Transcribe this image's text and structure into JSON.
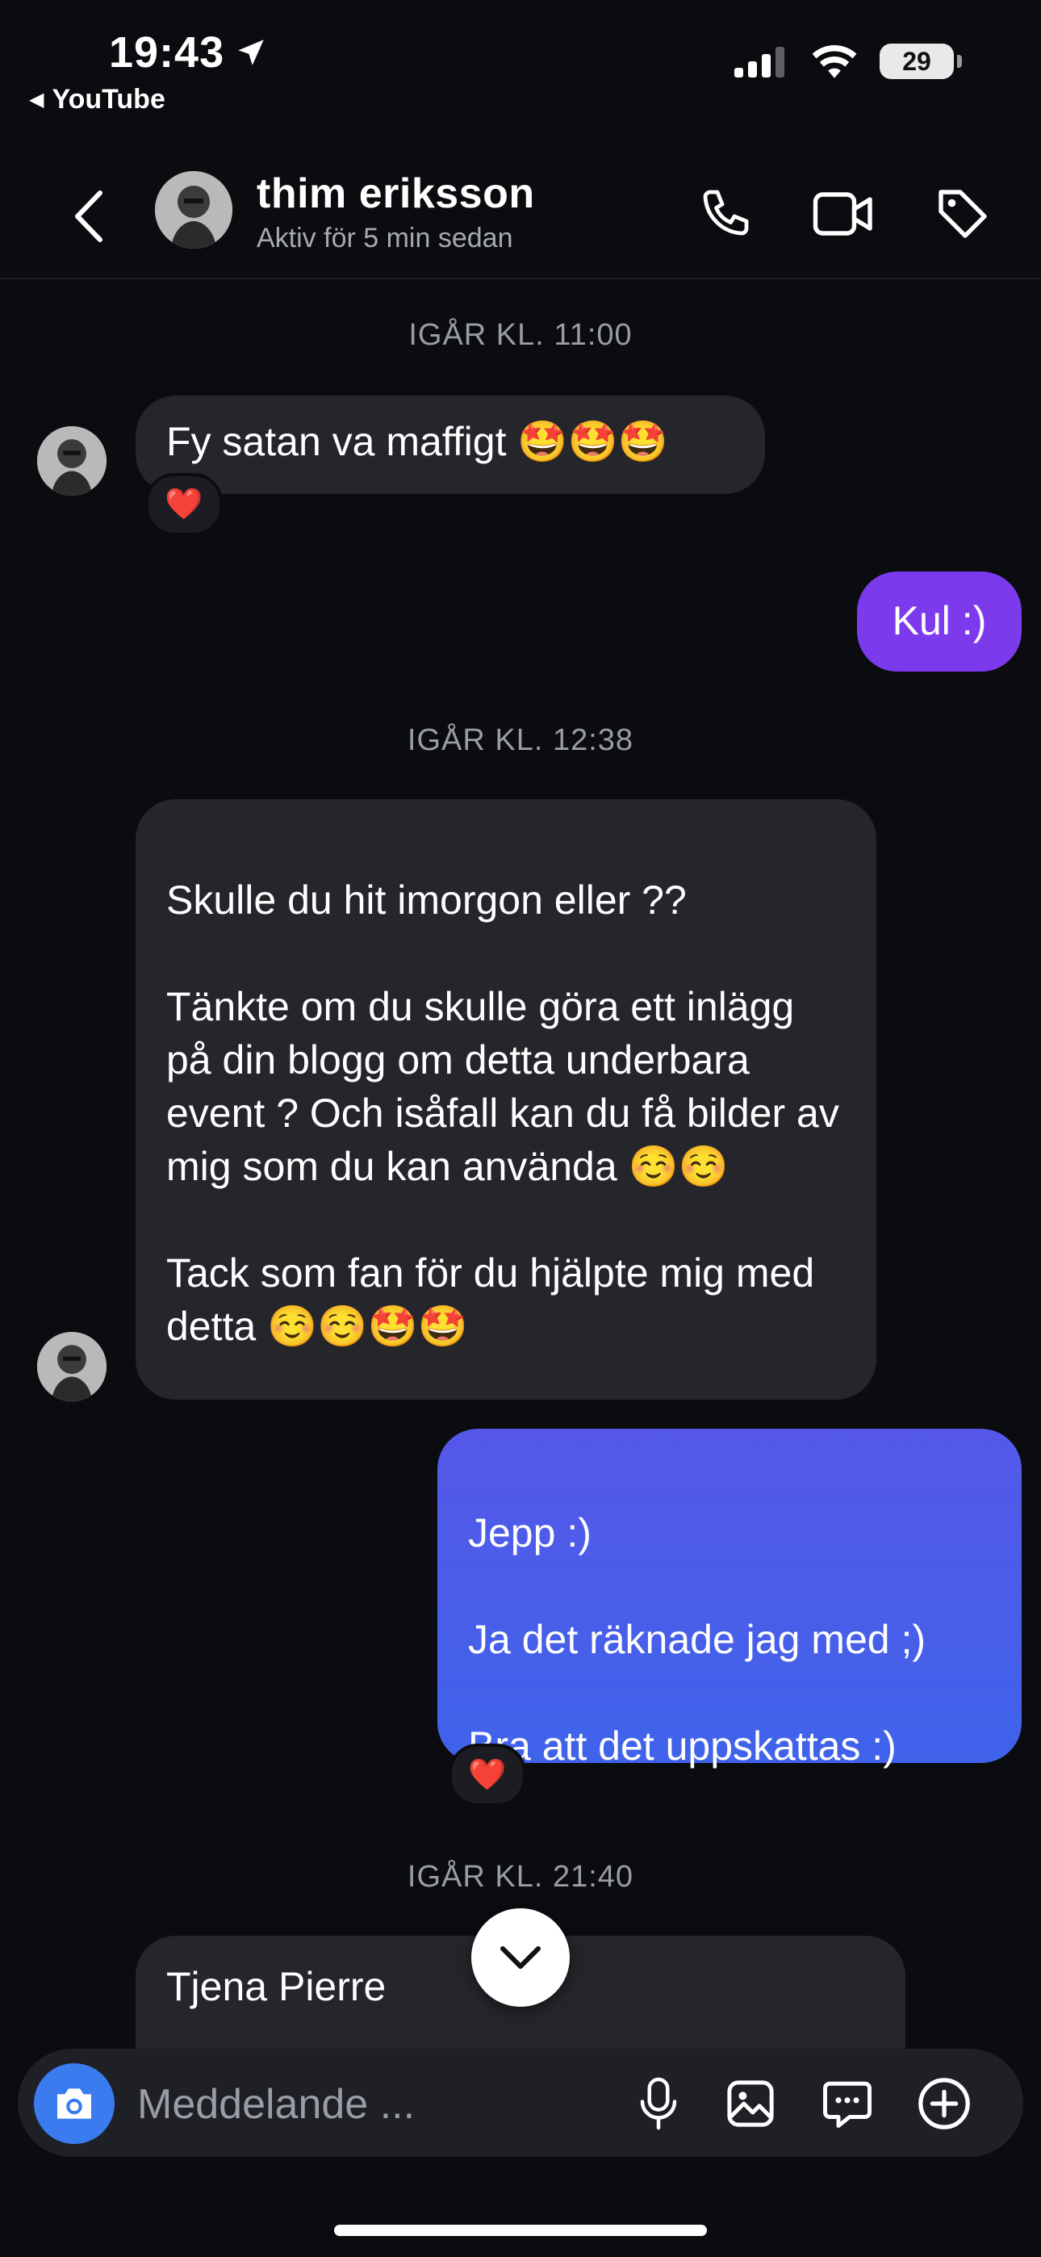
{
  "status_bar": {
    "time": "19:43",
    "back_app": "YouTube",
    "battery": "29"
  },
  "header": {
    "name": "thim eriksson",
    "status": "Aktiv för 5 min sedan"
  },
  "messages": {
    "sep1": "IGÅR KL. 11:00",
    "m1": "Fy satan va maffigt 🤩🤩🤩",
    "m1_reaction": "❤️",
    "m2": "Kul :)",
    "sep2": "IGÅR KL. 12:38",
    "m3": "Skulle du hit imorgon eller ??\n\nTänkte om du skulle göra ett inlägg på din blogg om detta underbara event ? Och isåfall kan du få bilder av mig som du kan använda ☺️☺️\n\nTack som fan för du hjälpte mig med detta ☺️☺️🤩🤩",
    "m4": "Jepp :)\n\nJa det räknade jag med ;)\n\nBra att det uppskattas :)",
    "m4_reaction": "❤️",
    "sep3": "IGÅR KL. 21:40",
    "m5": "Tjena Pierre"
  },
  "composer": {
    "placeholder": "Meddelande ..."
  },
  "colors": {
    "background": "#0b0c10",
    "incoming_bubble": "#25262b",
    "outgoing_purple": "#7c3aed",
    "outgoing_blue_top": "#5558e8",
    "outgoing_blue_bottom": "#3f63ea",
    "camera_button": "#3a7bf0"
  },
  "icons": [
    "location-arrow-icon",
    "signal-icon",
    "wifi-icon",
    "back-chevron-icon",
    "phone-icon",
    "video-icon",
    "tag-icon",
    "chevron-down-icon",
    "camera-icon",
    "microphone-icon",
    "image-icon",
    "sticker-chat-icon",
    "plus-circle-icon"
  ]
}
